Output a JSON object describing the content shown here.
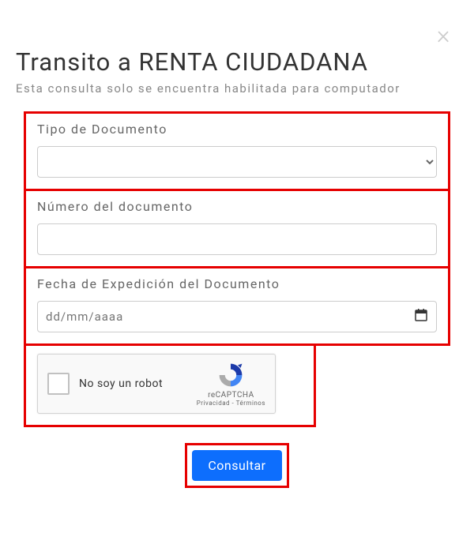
{
  "modal": {
    "title": "Transito a RENTA CIUDADANA",
    "subtitle": "Esta consulta solo se encuentra habilitada para computador"
  },
  "form": {
    "doc_type": {
      "label": "Tipo de Documento",
      "value": ""
    },
    "doc_number": {
      "label": "Número del documento",
      "value": ""
    },
    "doc_date": {
      "label": "Fecha de Expedición del Documento",
      "placeholder": "dd/mm/aaaa",
      "value": ""
    },
    "recaptcha": {
      "label": "No soy un robot",
      "brand": "reCAPTCHA",
      "links": "Privacidad - Términos"
    },
    "submit_label": "Consultar"
  }
}
